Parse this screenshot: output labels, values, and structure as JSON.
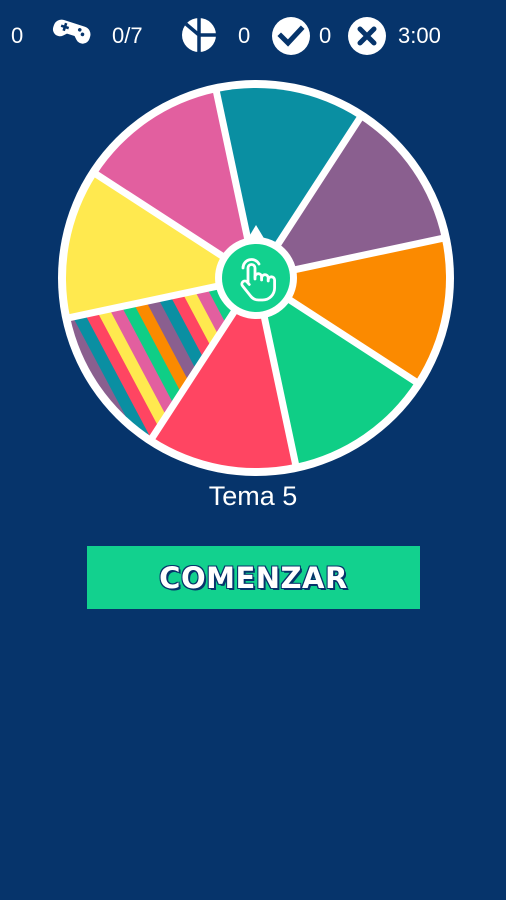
{
  "header": {
    "games_count": "0",
    "games_icon": "gamepad-icon",
    "progress": "0/7",
    "categories_icon": "pie-chart-icon",
    "categories_count": "0",
    "correct_icon": "check-circle-icon",
    "correct_count": "0",
    "wrong_icon": "close-circle-icon",
    "timer": "3:00"
  },
  "wheel": {
    "segment_colors": [
      "#0a8fa2",
      "#8a5f8f",
      "#fb8a00",
      "#0fce86",
      "#ff4562",
      "stripes",
      "#ffe94f",
      "#e25f9f"
    ],
    "stripe_colors": [
      "#0fce86",
      "#fb8a00",
      "#8a5f8f",
      "#0a8fa2",
      "#ff4562",
      "#ffe94f",
      "#e25f9f"
    ],
    "spin_icon": "hand-tap-icon",
    "accent_color": "#12d18e"
  },
  "topic": {
    "label": "Tema 5"
  },
  "actions": {
    "start_label": "COMENZAR"
  },
  "colors": {
    "background": "#06346b",
    "button": "#12d18e"
  }
}
